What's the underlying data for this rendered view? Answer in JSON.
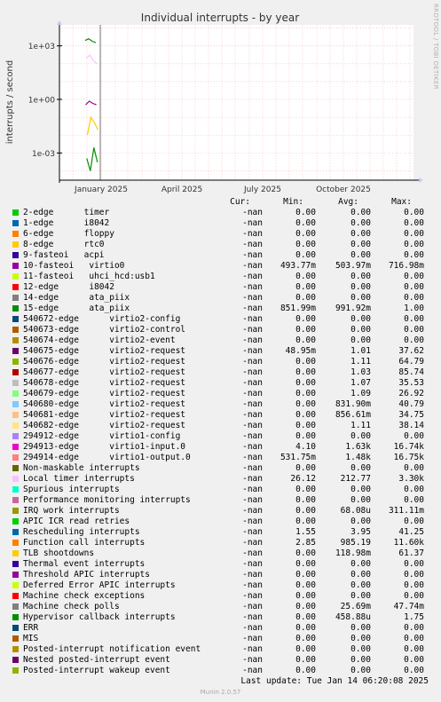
{
  "chart_data": {
    "type": "line",
    "title": "Individual interrupts - by year",
    "ylabel": "interrupts / second",
    "xlabel": "",
    "y_scale": "log",
    "ylim": [
      3e-05,
      15000
    ],
    "y_ticks": [
      {
        "value": 1000,
        "label": "1e+03"
      },
      {
        "value": 1,
        "label": "1e+00"
      },
      {
        "value": 0.001,
        "label": "1e-03"
      }
    ],
    "x_ticks": [
      "January 2025",
      "April 2025",
      "July 2025",
      "October 2025"
    ],
    "grid": true,
    "series": [
      {
        "name": "15-edge",
        "values": [
          2000,
          2500,
          1800,
          1500
        ]
      },
      {
        "name": "10-fasteoi",
        "values": [
          0.5,
          0.8,
          0.6,
          0.5
        ]
      },
      {
        "name": "Local timer interrupts",
        "values": [
          200,
          300,
          150,
          100
        ]
      },
      {
        "name": "Hypervisor callback interrupts",
        "values": [
          0.0005,
          0.0001,
          0.002,
          0.0003
        ]
      },
      {
        "name": "TLB shootdowns",
        "values": [
          0.01,
          0.1,
          0.05,
          0.02
        ]
      }
    ]
  },
  "header": {
    "cur": "Cur:",
    "min": "Min:",
    "avg": "Avg:",
    "max": "Max:"
  },
  "legend": [
    {
      "name": "2-edge      timer",
      "color": "#00cc00",
      "cur": "-nan",
      "min": "0.00",
      "avg": "0.00",
      "max": "0.00"
    },
    {
      "name": "1-edge      i8042",
      "color": "#0066b3",
      "cur": "-nan",
      "min": "0.00",
      "avg": "0.00",
      "max": "0.00"
    },
    {
      "name": "6-edge      floppy",
      "color": "#ff8000",
      "cur": "-nan",
      "min": "0.00",
      "avg": "0.00",
      "max": "0.00"
    },
    {
      "name": "8-edge      rtc0",
      "color": "#ffcc00",
      "cur": "-nan",
      "min": "0.00",
      "avg": "0.00",
      "max": "0.00"
    },
    {
      "name": "9-fasteoi   acpi",
      "color": "#330099",
      "cur": "-nan",
      "min": "0.00",
      "avg": "0.00",
      "max": "0.00"
    },
    {
      "name": "10-fasteoi   virtio0",
      "color": "#990099",
      "cur": "-nan",
      "min": "493.77m",
      "avg": "503.97m",
      "max": "716.98m"
    },
    {
      "name": "11-fasteoi   uhci_hcd:usb1",
      "color": "#ccff00",
      "cur": "-nan",
      "min": "0.00",
      "avg": "0.00",
      "max": "0.00"
    },
    {
      "name": "12-edge      i8042",
      "color": "#ff0000",
      "cur": "-nan",
      "min": "0.00",
      "avg": "0.00",
      "max": "0.00"
    },
    {
      "name": "14-edge      ata_piix",
      "color": "#808080",
      "cur": "-nan",
      "min": "0.00",
      "avg": "0.00",
      "max": "0.00"
    },
    {
      "name": "15-edge      ata_piix",
      "color": "#008f00",
      "cur": "-nan",
      "min": "851.99m",
      "avg": "991.92m",
      "max": "1.00"
    },
    {
      "name": "540672-edge      virtio2-config",
      "color": "#00487d",
      "cur": "-nan",
      "min": "0.00",
      "avg": "0.00",
      "max": "0.00"
    },
    {
      "name": "540673-edge      virtio2-control",
      "color": "#b35a00",
      "cur": "-nan",
      "min": "0.00",
      "avg": "0.00",
      "max": "0.00"
    },
    {
      "name": "540674-edge      virtio2-event",
      "color": "#b38f00",
      "cur": "-nan",
      "min": "0.00",
      "avg": "0.00",
      "max": "0.00"
    },
    {
      "name": "540675-edge      virtio2-request",
      "color": "#6b006b",
      "cur": "-nan",
      "min": "48.95m",
      "avg": "1.01",
      "max": "37.62"
    },
    {
      "name": "540676-edge      virtio2-request",
      "color": "#8fb300",
      "cur": "-nan",
      "min": "0.00",
      "avg": "1.11",
      "max": "64.79"
    },
    {
      "name": "540677-edge      virtio2-request",
      "color": "#b30000",
      "cur": "-nan",
      "min": "0.00",
      "avg": "1.03",
      "max": "85.74"
    },
    {
      "name": "540678-edge      virtio2-request",
      "color": "#bebebe",
      "cur": "-nan",
      "min": "0.00",
      "avg": "1.07",
      "max": "35.53"
    },
    {
      "name": "540679-edge      virtio2-request",
      "color": "#80ff80",
      "cur": "-nan",
      "min": "0.00",
      "avg": "1.09",
      "max": "26.92"
    },
    {
      "name": "540680-edge      virtio2-request",
      "color": "#80c9ff",
      "cur": "-nan",
      "min": "0.00",
      "avg": "831.90m",
      "max": "40.79"
    },
    {
      "name": "540681-edge      virtio2-request",
      "color": "#ffc080",
      "cur": "-nan",
      "min": "0.00",
      "avg": "856.61m",
      "max": "34.75"
    },
    {
      "name": "540682-edge      virtio2-request",
      "color": "#ffe680",
      "cur": "-nan",
      "min": "0.00",
      "avg": "1.11",
      "max": "38.14"
    },
    {
      "name": "294912-edge      virtio1-config",
      "color": "#aa80ff",
      "cur": "-nan",
      "min": "0.00",
      "avg": "0.00",
      "max": "0.00"
    },
    {
      "name": "294913-edge      virtio1-input.0",
      "color": "#ee00cc",
      "cur": "-nan",
      "min": "4.10",
      "avg": "1.63k",
      "max": "16.74k"
    },
    {
      "name": "294914-edge      virtio1-output.0",
      "color": "#ff8080",
      "cur": "-nan",
      "min": "531.75m",
      "avg": "1.48k",
      "max": "16.75k"
    },
    {
      "name": "Non-maskable interrupts",
      "color": "#666600",
      "cur": "-nan",
      "min": "0.00",
      "avg": "0.00",
      "max": "0.00"
    },
    {
      "name": "Local timer interrupts",
      "color": "#ffbfff",
      "cur": "-nan",
      "min": "26.12",
      "avg": "212.77",
      "max": "3.30k"
    },
    {
      "name": "Spurious interrupts",
      "color": "#00ffcc",
      "cur": "-nan",
      "min": "0.00",
      "avg": "0.00",
      "max": "0.00"
    },
    {
      "name": "Performance monitoring interrupts",
      "color": "#cc6699",
      "cur": "-nan",
      "min": "0.00",
      "avg": "0.00",
      "max": "0.00"
    },
    {
      "name": "IRQ work interrupts",
      "color": "#999900",
      "cur": "-nan",
      "min": "0.00",
      "avg": "68.08u",
      "max": "311.11m"
    },
    {
      "name": "APIC ICR read retries",
      "color": "#00cc00",
      "cur": "-nan",
      "min": "0.00",
      "avg": "0.00",
      "max": "0.00"
    },
    {
      "name": "Rescheduling interrupts",
      "color": "#0066b3",
      "cur": "-nan",
      "min": "1.55",
      "avg": "3.95",
      "max": "41.25"
    },
    {
      "name": "Function call interrupts",
      "color": "#ff8000",
      "cur": "-nan",
      "min": "2.85",
      "avg": "985.19",
      "max": "11.60k"
    },
    {
      "name": "TLB shootdowns",
      "color": "#ffcc00",
      "cur": "-nan",
      "min": "0.00",
      "avg": "118.98m",
      "max": "61.37"
    },
    {
      "name": "Thermal event interrupts",
      "color": "#330099",
      "cur": "-nan",
      "min": "0.00",
      "avg": "0.00",
      "max": "0.00"
    },
    {
      "name": "Threshold APIC interrupts",
      "color": "#990099",
      "cur": "-nan",
      "min": "0.00",
      "avg": "0.00",
      "max": "0.00"
    },
    {
      "name": "Deferred Error APIC interrupts",
      "color": "#ccff00",
      "cur": "-nan",
      "min": "0.00",
      "avg": "0.00",
      "max": "0.00"
    },
    {
      "name": "Machine check exceptions",
      "color": "#ff0000",
      "cur": "-nan",
      "min": "0.00",
      "avg": "0.00",
      "max": "0.00"
    },
    {
      "name": "Machine check polls",
      "color": "#808080",
      "cur": "-nan",
      "min": "0.00",
      "avg": "25.69m",
      "max": "47.74m"
    },
    {
      "name": "Hypervisor callback interrupts",
      "color": "#008f00",
      "cur": "-nan",
      "min": "0.00",
      "avg": "458.88u",
      "max": "1.75"
    },
    {
      "name": "ERR",
      "color": "#00487d",
      "cur": "-nan",
      "min": "0.00",
      "avg": "0.00",
      "max": "0.00"
    },
    {
      "name": "MIS",
      "color": "#b35a00",
      "cur": "-nan",
      "min": "0.00",
      "avg": "0.00",
      "max": "0.00"
    },
    {
      "name": "Posted-interrupt notification event",
      "color": "#b38f00",
      "cur": "-nan",
      "min": "0.00",
      "avg": "0.00",
      "max": "0.00"
    },
    {
      "name": "Nested posted-interrupt event",
      "color": "#6b006b",
      "cur": "-nan",
      "min": "0.00",
      "avg": "0.00",
      "max": "0.00"
    },
    {
      "name": "Posted-interrupt wakeup event",
      "color": "#8fb300",
      "cur": "-nan",
      "min": "0.00",
      "avg": "0.00",
      "max": "0.00"
    }
  ],
  "last_update": "Last update: Tue Jan 14 06:20:08 2025",
  "footer": "Munin 2.0.57",
  "side_label": "RRDTOOL / TOBI OETIKER"
}
